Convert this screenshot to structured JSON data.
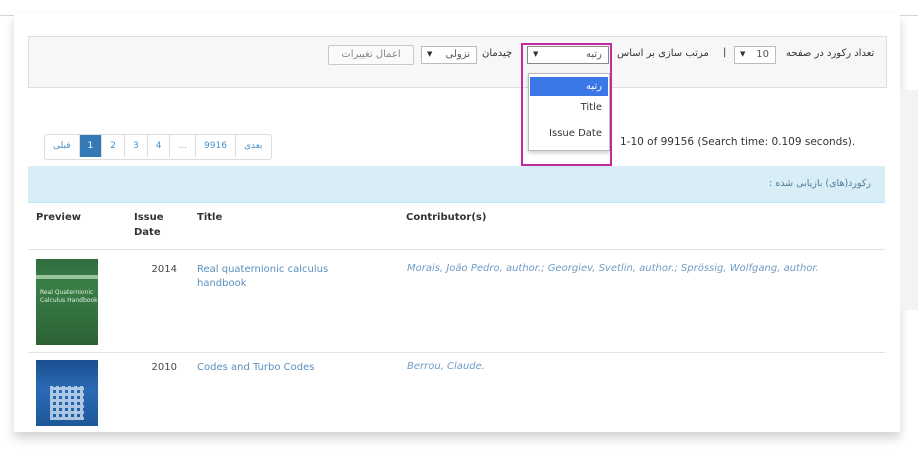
{
  "filter_bar": {
    "records_per_page_label": "تعداد رکورد در صفحه",
    "records_per_page_value": "10",
    "sort_by_label": "مرتب سازی بر اساس",
    "sort_by_value": "رتبه",
    "order_label": "چیدمان",
    "order_value": "نزولی",
    "apply_button": "اعمال تغییرات",
    "separator": "|"
  },
  "sort_dropdown": {
    "options": [
      "رتبه",
      "Title",
      "Issue Date"
    ],
    "selected_index": 0
  },
  "pagination": {
    "prev": "قبلی",
    "pages": [
      "1",
      "2",
      "3",
      "4",
      "...",
      "9916"
    ],
    "next": "بعدی",
    "active_page": "1"
  },
  "results_info": "1-10 of 99156 (Search time: 0.109 seconds).",
  "results_banner": "رکورد(های) بازیابی شده :",
  "table": {
    "headers": {
      "preview": "Preview",
      "issue_date_line1": "Issue",
      "issue_date_line2": "Date",
      "title": "Title",
      "contributors": "Contributor(s)"
    },
    "rows": [
      {
        "year": "2014",
        "title_line1": "Real quaternionic calculus",
        "title_line2": "handbook",
        "contributors": "Morais, João Pedro, author.; Georgiev, Svetlin, author.; Sprössig, Wolfgang, author.",
        "cover_text": "Real Quaternionic Calculus Handbook"
      },
      {
        "year": "2010",
        "title_line1": "Codes and Turbo Codes",
        "title_line2": "",
        "contributors": "Berrou, Claude."
      }
    ]
  }
}
